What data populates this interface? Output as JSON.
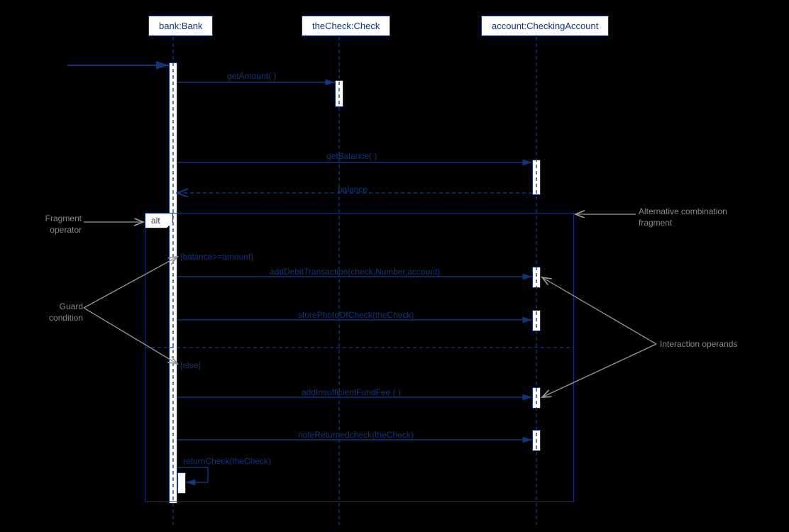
{
  "lifelines": {
    "bank": "bank:Bank",
    "check": "theCheck:Check",
    "account": "account:CheckingAccount"
  },
  "messages": {
    "getAmount": "getAmount( )",
    "getBalance": "getBalance( )",
    "balance": "balance",
    "addDebit": "addDebitTransaction(check,Number,account)",
    "storePhoto": "storePhotoOfCheck(theCheck)",
    "addFee": "addInsufficientFundFee ( )",
    "noteReturned": "noteReturnedcheck(theCheck)",
    "returnCheck": "returnCheck(theCheck)"
  },
  "fragment": {
    "operator": "alt",
    "guard1": "[balance>=amount]",
    "guard2": "[else]"
  },
  "annotations": {
    "fragOp": "Fragment\noperator",
    "guardCond": "Guard\ncondition",
    "altFrag": "Alternative combination\nfragment",
    "interOp": "Interaction operands"
  }
}
